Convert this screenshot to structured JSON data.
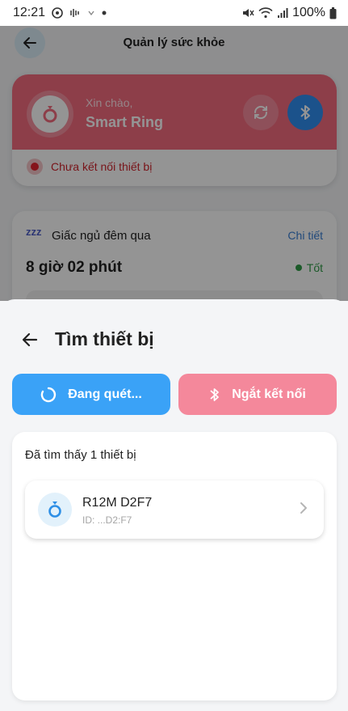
{
  "status_bar": {
    "time": "12:21",
    "battery": "100%"
  },
  "header": {
    "title": "Quản lý sức khỏe"
  },
  "greeting_card": {
    "hello": "Xin chào,",
    "name": "Smart Ring",
    "connection_status": "Chưa kết nối thiết bị",
    "accent_color": "#f36b7f"
  },
  "sleep_card": {
    "icon_text": "zzz",
    "title": "Giấc ngủ đêm qua",
    "detail_link": "Chi tiết",
    "duration": "8 giờ 02 phút",
    "quality": "Tốt"
  },
  "sheet": {
    "title": "Tìm thiết bị",
    "scan_label": "Đang quét...",
    "disconnect_label": "Ngắt kết nối",
    "found_count": "Đã tìm thấy 1 thiết bị",
    "devices": [
      {
        "name": "R12M D2F7",
        "id": "ID: ...D2:F7",
        "icon": "ring-icon"
      }
    ]
  },
  "colors": {
    "scan_button": "#3aa2f7",
    "disconnect_button": "#f4889b",
    "bluetooth_button": "#2f8ef0"
  }
}
